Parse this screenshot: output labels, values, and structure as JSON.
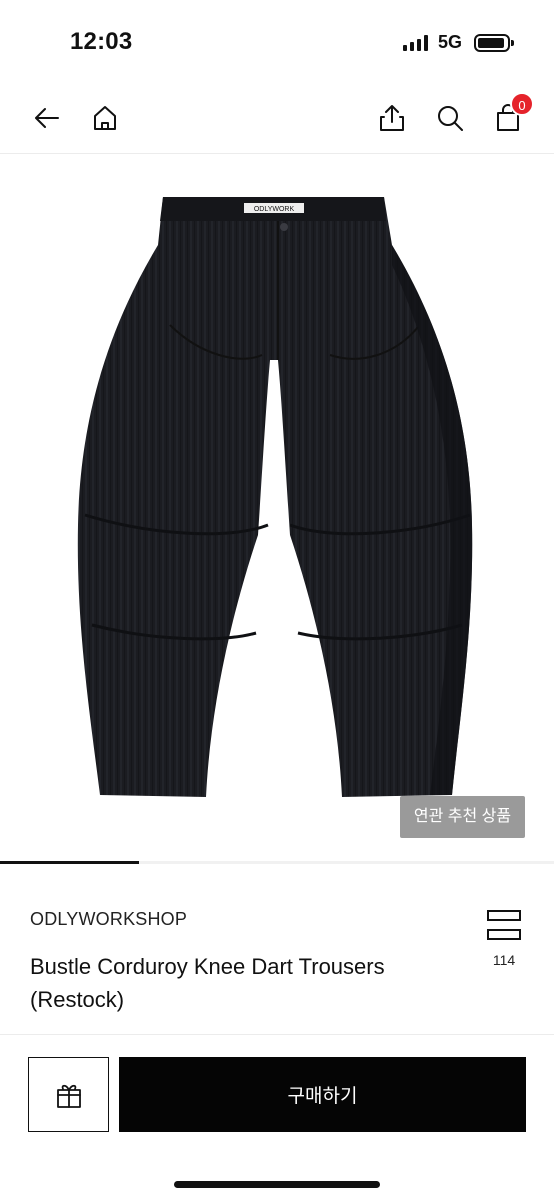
{
  "status_bar": {
    "time": "12:03",
    "network": "5G",
    "icons": [
      "signal-icon",
      "battery-icon"
    ]
  },
  "nav": {
    "icons": [
      "back-arrow-icon",
      "home-icon",
      "share-icon",
      "search-icon",
      "cart-icon"
    ],
    "cart_count": "0",
    "badge_color": "#e5232b"
  },
  "hero": {
    "product_image": "black corduroy barrel trousers",
    "related_label": "연관 추천 상품",
    "gallery_progress": 0.25
  },
  "product": {
    "brand": "ODLYWORKSHOP",
    "title": "Bustle Corduroy Knee Dart Trousers (Restock)",
    "wish_count": "114",
    "wish_icon": "stacked-boxes-icon"
  },
  "actions": {
    "gift_icon": "gift-icon",
    "buy_label": "구매하기"
  }
}
